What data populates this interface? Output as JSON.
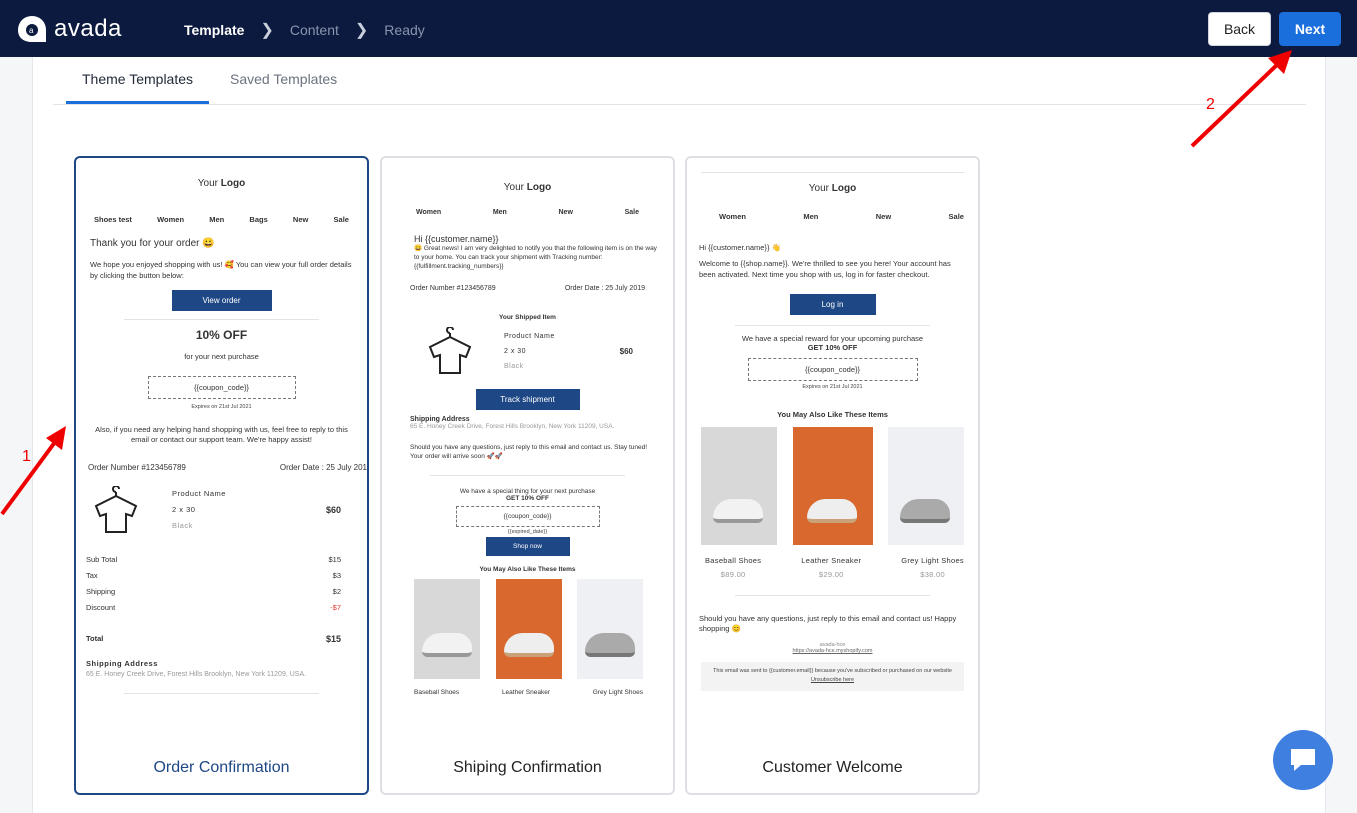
{
  "app": {
    "name": "avada"
  },
  "steps": [
    "Template",
    "Content",
    "Ready"
  ],
  "header": {
    "back_label": "Back",
    "next_label": "Next"
  },
  "tabs": [
    "Theme Templates",
    "Saved Templates"
  ],
  "colors": {
    "topbar": "#0b1a3e",
    "accent": "#1a6fdc",
    "selected_border": "#1e4785",
    "annotation": "#e00000"
  },
  "annotations": [
    "1",
    "2"
  ],
  "templates": [
    {
      "title": "Order Confirmation",
      "logo_your": "Your",
      "logo_word": "Logo",
      "nav": [
        "Shoes test",
        "Women",
        "Men",
        "Bags",
        "New",
        "Sale"
      ],
      "greeting": "Thank you for your order 😀",
      "intro": "We hope you enjoyed shopping with us! 🥰 You can view your full order details by clicking the button below:",
      "button": "View order",
      "discount": "10% OFF",
      "discount_sub": "for your next purchase",
      "coupon": "{{coupon_code}}",
      "expires": "Expires on 21st Jul 2021",
      "help": "Also, if you need any helping hand shopping with us, feel free to reply to this email or contact our support team. We're happy assist!",
      "order_number": "Order Number #123456789",
      "order_date": "Order Date : 25 July 201",
      "product_name": "Product Name",
      "product_size": "2 x 30",
      "product_color": "Black",
      "product_price": "$60",
      "totals": [
        {
          "label": "Sub Total",
          "value": "$15"
        },
        {
          "label": "Tax",
          "value": "$3"
        },
        {
          "label": "Shipping",
          "value": "$2"
        },
        {
          "label": "Discount",
          "value": "-$7"
        }
      ],
      "total_label": "Total",
      "total_value": "$15",
      "shipping_title": "Shipping Address",
      "shipping_address": "65 E. Honey Creek Drive, Forest Hills Brooklyn, New York 11209, USA."
    },
    {
      "title": "Shiping Confirmation",
      "logo_your": "Your",
      "logo_word": "Logo",
      "nav": [
        "Women",
        "Men",
        "New",
        "Sale"
      ],
      "greeting": "Hi {{customer.name}}",
      "intro": "😀 Great news! I am very delighted to notify you that the following item is on the way to your home. You can track your shipment with Tracking number: {{fulfillment.tracking_numbers}}",
      "order_number": "Order Number #123456789",
      "order_date": "Order Date : 25 July 2019",
      "item_title": "Your Shipped Item",
      "product_name": "Product Name",
      "product_size": "2 x 30",
      "product_color": "Black",
      "product_price": "$60",
      "button": "Track shipment",
      "shipping_title": "Shipping Address",
      "shipping_address": "65 E. Honey Creek Drive, Forest Hills Brooklyn, New York 11209, USA.",
      "questions": "Should you have any questions, just reply to this email and contact us. Stay tuned! Your order will arrive soon 🚀🚀",
      "special": "We have a special thing for your next purchase",
      "discount": "GET 10% OFF",
      "coupon": "{{coupon_code}}",
      "expired": "{{expired_date}}",
      "shop_button": "Shop now",
      "also_like": "You May Also Like These Items",
      "items": [
        "Baseball Shoes",
        "Leather Sneaker",
        "Grey Light Shoes"
      ]
    },
    {
      "title": "Customer Welcome",
      "logo_your": "Your",
      "logo_word": "Logo",
      "nav": [
        "Women",
        "Men",
        "New",
        "Sale"
      ],
      "greeting": "Hi {{customer.name}} 👋",
      "intro": "Welcome to {{shop.name}}. We're thrilled to see you here! Your account has been activated. Next time you shop with us, log in for faster checkout.",
      "button": "Log in",
      "reward": "We have a special reward for your upcoming purchase",
      "discount": "GET 10% OFF",
      "coupon": "{{coupon_code}}",
      "expires": "Expires on 21st Jul 2021",
      "also_like": "You May Also Like These Items",
      "items": [
        {
          "name": "Baseball Shoes",
          "price": "$89.00"
        },
        {
          "name": "Leather Sneaker",
          "price": "$29.00"
        },
        {
          "name": "Grey Light Shoes",
          "price": "$38.00"
        }
      ],
      "questions": "Should you have any questions, just reply to this email and contact us! Happy shopping 😊",
      "shop_name": "avada-hce",
      "shop_url": "https://avada-hce.myshopify.com",
      "footer": "This email was sent to {{customer.email}} because you've subscribed or purchased on our website",
      "unsubscribe": "Unsubscribe here"
    }
  ]
}
